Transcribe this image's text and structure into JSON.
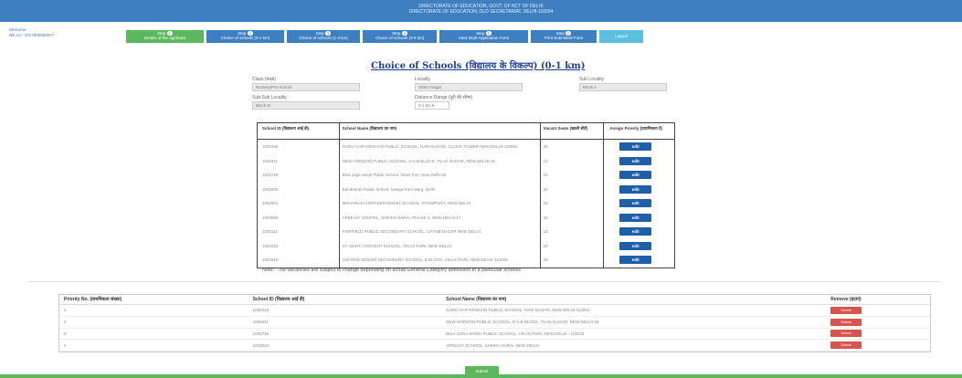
{
  "header": {
    "line1": "DIRECTORATE OF EDUCATION, GOVT. OF NCT OF DELHI",
    "line2": "DIRECTORATE OF EDUCATION, OLD SECRETARIAT, DELHI-110054"
  },
  "welcome": {
    "line1": "Welcome",
    "line2": "Nlk Ao : 2017000000077"
  },
  "steps": [
    {
      "step": "Step",
      "num": "1",
      "label": "Details of the applicant"
    },
    {
      "step": "Step",
      "num": "2",
      "label": "Choice of schools (0-1 km)"
    },
    {
      "step": "Step",
      "num": "3",
      "label": "Choice of schools (1-3 km)"
    },
    {
      "step": "Step",
      "num": "4",
      "label": "Choice of schools (3-6 km)"
    },
    {
      "step": "Step",
      "num": "5",
      "label": "View Draft Application Form"
    },
    {
      "step": "Step",
      "num": "6",
      "label": "Print Submitted Form"
    },
    {
      "step": "",
      "num": "",
      "label": "Logout"
    }
  ],
  "title": "Choice of Schools (विद्यालय के विकल्प) (0-1 km)",
  "filters": {
    "class_label": "Class (कक्षा)",
    "class_value": "Nursery/Pre-School",
    "locality_label": "Locality",
    "locality_value": "Uttam Nagar",
    "sublocality_label": "Sub Locality",
    "sublocality_value": "Block A",
    "subsub_label": "Sub-Sub Locality",
    "subsub_value": "Block M",
    "distance_label": "Distance Range (दूरी की सीमा)",
    "distance_value": "0-1 km"
  },
  "school_table": {
    "headers": [
      "School ID (विद्यालय आई डी)",
      "School Name (विद्यालय का नाम)",
      "Vacant Seats (खाली सीटें)",
      "Assign Priority (प्राथमिकता दें)"
    ],
    "edit_label": "edit",
    "rows": [
      {
        "id": "1002345",
        "name": "GURU HAR KRISHAN PUBLIC SCHOOL, HARI NAGAR, CLOCK TOWER NEW DELHI-110064",
        "seats": "25"
      },
      {
        "id": "1002411",
        "name": "NEW HORIZON PUBLIC SCHOOL, D-1-B BLOCK, TILAK NAGAR, NEW DELHI-18",
        "seats": "12"
      },
      {
        "id": "1002718",
        "name": "Bhai Joga Singh Public School, Vikas Puri, New Delhi-18",
        "seats": "15"
      },
      {
        "id": "1002830",
        "name": "Bal Bharati Public School, Ganga Ram Marg, Delhi",
        "seats": "20"
      },
      {
        "id": "1002901",
        "name": "MAHARAJA AGRASEN MODEL SCHOOL, PITAMPURA, NEW DELHI",
        "seats": "18"
      },
      {
        "id": "1003004",
        "name": "APEEJAY SCHOOL, SHEIKH SARAI, PHASE-1, NEW DELHI-17",
        "seats": "40"
      },
      {
        "id": "1003112",
        "name": "FAIRFIELD PUBLIC SECONDARY SCHOOL, UTTAM NAGAR NEW DELHI",
        "seats": "12"
      },
      {
        "id": "1003215",
        "name": "ST. MARY CONVENT SCHOOL, VIKAS PURI, NEW DELHI",
        "seats": "10"
      },
      {
        "id": "1003310",
        "name": "OXFORD SENIOR SECONDARY SCHOOL, B BLOCK, VIKAS PURI, NEW DELHI-110018",
        "seats": "40"
      }
    ]
  },
  "note": "Note:- The vacancies are subject to change depending on actual General Category admission in a particular schools",
  "priority_table": {
    "headers": [
      "Priority No. (प्राथमिकता संख्या)",
      "School ID (विद्यालय आई डी)",
      "School Name (विद्यालय का नाम)",
      "Remove (हटाएं)"
    ],
    "delete_label": "Delete",
    "rows": [
      {
        "no": "1",
        "id": "1002345",
        "name": "GURU HAR KRISHAN PUBLIC SCHOOL, HARI NAGAR, NEW DELHI-110064"
      },
      {
        "no": "2",
        "id": "1002411",
        "name": "NEW HORIZON PUBLIC SCHOOL, D-1-B BLOCK, TILAK NAGAR, NEW DELHI-18"
      },
      {
        "no": "3",
        "id": "1002718",
        "name": "BHAI JOGA SINGH PUBLIC SCHOOL, VIKAS PURI, NEW DELHI - 110018"
      },
      {
        "no": "4",
        "id": "1003004",
        "name": "APEEJAY SCHOOL, SHEIKH SARAI, NEW DELHI"
      }
    ]
  },
  "submit_label": "Submit",
  "colors": {
    "header": "#3d7fc0",
    "step_done": "#5cb85c",
    "step_todo": "#3d7fc0",
    "edit": "#1e5fa9",
    "delete": "#d9534f",
    "title": "#1f3f9f"
  }
}
